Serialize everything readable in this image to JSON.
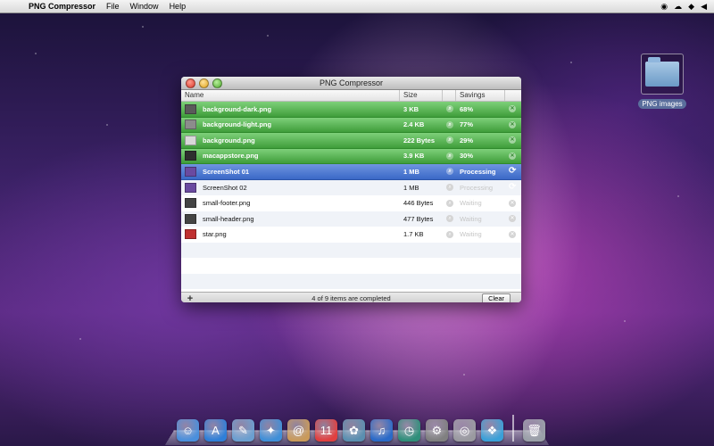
{
  "menubar": {
    "apple_glyph": "",
    "app_name": "PNG Compressor",
    "items": [
      "File",
      "Window",
      "Help"
    ],
    "status_icons": [
      "◉",
      "☁",
      "◆",
      "◀"
    ]
  },
  "desktop": {
    "folder_label": "PNG images"
  },
  "window": {
    "title": "PNG Compressor",
    "columns": {
      "name": "Name",
      "size": "Size",
      "savings": "Savings"
    },
    "footer": {
      "status": "4 of 9 items are completed",
      "clear_label": "Clear",
      "add_label": "+"
    }
  },
  "rows": [
    {
      "name": "background-dark.png",
      "size": "3 KB",
      "savings": "68%",
      "state": "done",
      "thumb": "#5a5a5a"
    },
    {
      "name": "background-light.png",
      "size": "2.4 KB",
      "savings": "77%",
      "state": "done",
      "thumb": "#8c8c8c"
    },
    {
      "name": "background.png",
      "size": "222 Bytes",
      "savings": "29%",
      "state": "done",
      "thumb": "#d8d8d8"
    },
    {
      "name": "macappstore.png",
      "size": "3.9 KB",
      "savings": "30%",
      "state": "done",
      "thumb": "#2e2e2e"
    },
    {
      "name": "ScreenShot 01",
      "size": "1 MB",
      "savings": "Processing",
      "state": "active",
      "thumb": "#6a4aa0"
    },
    {
      "name": "ScreenShot 02",
      "size": "1 MB",
      "savings": "Processing",
      "state": "pending",
      "thumb": "#6a4aa0"
    },
    {
      "name": "small-footer.png",
      "size": "446 Bytes",
      "savings": "Waiting",
      "state": "pending",
      "thumb": "#444444"
    },
    {
      "name": "small-header.png",
      "size": "477 Bytes",
      "savings": "Waiting",
      "state": "pending",
      "thumb": "#444444"
    },
    {
      "name": "star.png",
      "size": "1.7 KB",
      "savings": "Waiting",
      "state": "pending",
      "thumb": "#c03030"
    }
  ],
  "dock": [
    {
      "name": "finder-icon",
      "glyph": "☺",
      "color": "#4a8fdc"
    },
    {
      "name": "app-store-icon",
      "glyph": "A",
      "color": "#2f7fd8"
    },
    {
      "name": "preview-icon",
      "glyph": "✎",
      "color": "#6b9fd0"
    },
    {
      "name": "safari-icon",
      "glyph": "✦",
      "color": "#3f8fd8"
    },
    {
      "name": "address-book-icon",
      "glyph": "@",
      "color": "#c99a5a"
    },
    {
      "name": "ical-icon",
      "glyph": "11",
      "color": "#e04040"
    },
    {
      "name": "iphoto-icon",
      "glyph": "✿",
      "color": "#5a8fb0"
    },
    {
      "name": "itunes-icon",
      "glyph": "♫",
      "color": "#2a6ac8"
    },
    {
      "name": "time-machine-icon",
      "glyph": "◷",
      "color": "#2f8f7a"
    },
    {
      "name": "system-preferences-icon",
      "glyph": "⚙",
      "color": "#808080"
    },
    {
      "name": "dashboard-icon",
      "glyph": "◎",
      "color": "#9a9aa0"
    },
    {
      "name": "png-compressor-icon",
      "glyph": "❖",
      "color": "#3aa0d8"
    },
    {
      "name": "trash-icon",
      "glyph": "🗑",
      "color": "#9aa0a8"
    }
  ]
}
